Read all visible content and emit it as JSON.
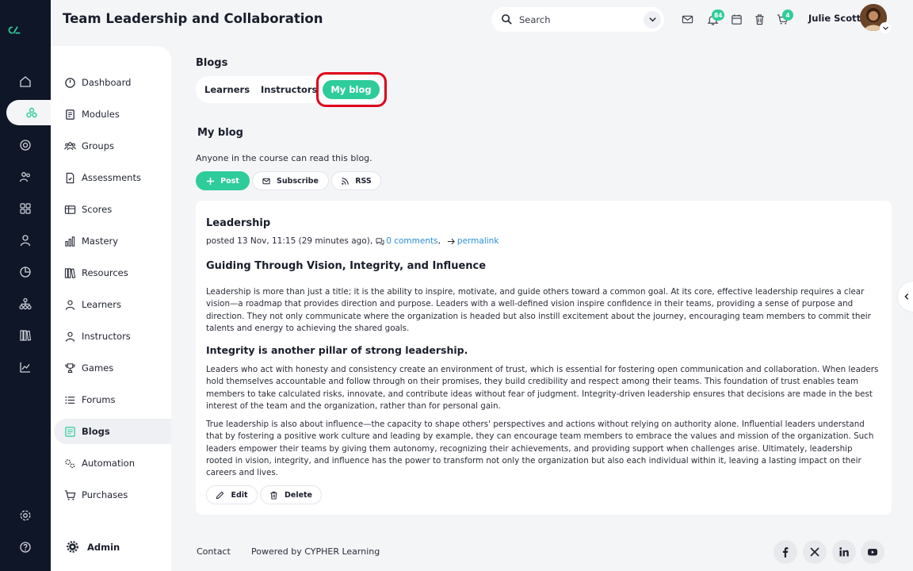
{
  "header": {
    "title": "Team Leadership and Collaboration",
    "search_placeholder": "Search",
    "notifications_count": "84",
    "cart_count": "4",
    "user_name": "Julie Scott"
  },
  "sidebar": {
    "items": [
      {
        "label": "Dashboard",
        "icon": "dashboard-icon"
      },
      {
        "label": "Modules",
        "icon": "modules-icon"
      },
      {
        "label": "Groups",
        "icon": "groups-icon"
      },
      {
        "label": "Assessments",
        "icon": "assessments-icon"
      },
      {
        "label": "Scores",
        "icon": "scores-icon"
      },
      {
        "label": "Mastery",
        "icon": "mastery-icon"
      },
      {
        "label": "Resources",
        "icon": "resources-icon"
      },
      {
        "label": "Learners",
        "icon": "learners-icon"
      },
      {
        "label": "Instructors",
        "icon": "instructors-icon"
      },
      {
        "label": "Games",
        "icon": "games-icon"
      },
      {
        "label": "Forums",
        "icon": "forums-icon"
      },
      {
        "label": "Blogs",
        "icon": "blogs-icon",
        "active": true
      },
      {
        "label": "Automation",
        "icon": "automation-icon"
      },
      {
        "label": "Purchases",
        "icon": "purchases-icon"
      }
    ],
    "admin_label": "Admin"
  },
  "main": {
    "section_title": "Blogs",
    "tabs": [
      {
        "label": "Learners"
      },
      {
        "label": "Instructors"
      },
      {
        "label": "My blog",
        "active": true
      }
    ],
    "blog_title": "My blog",
    "blog_description": "Anyone in the course can read this blog.",
    "actions": {
      "post": "Post",
      "subscribe": "Subscribe",
      "rss": "RSS"
    },
    "post": {
      "title": "Leadership",
      "posted": "posted 13 Nov, 11:15 (29 minutes ago),",
      "comments": "0 comments",
      "comma": ",",
      "permalink": "permalink",
      "heading": "Guiding Through Vision, Integrity, and Influence",
      "paragraph1": "Leadership is more than just a title; it is the ability to inspire, motivate, and guide others toward a common goal. At its core, effective leadership requires a clear vision—a roadmap that provides direction and purpose. Leaders with a well-defined vision inspire confidence in their teams, providing a sense of purpose and direction. They not only communicate where the organization is headed but also instill excitement about the journey, encouraging team members to commit their talents and energy to achieving the shared goals.",
      "subheading": "Integrity is another pillar of strong leadership.",
      "paragraph2": "Leaders who act with honesty and consistency create an environment of trust, which is essential for fostering open communication and collaboration. When leaders hold themselves accountable and follow through on their promises, they build credibility and respect among their teams. This foundation of trust enables team members to take calculated risks, innovate, and contribute ideas without fear of judgment. Integrity-driven leadership ensures that decisions are made in the best interest of the team and the organization, rather than for personal gain.",
      "paragraph3": "True leadership is also about influence—the capacity to shape others' perspectives and actions without relying on authority alone. Influential leaders understand that by fostering a positive work culture and leading by example, they can encourage team members to embrace the values and mission of the organization. Such leaders empower their teams by giving them autonomy, recognizing their achievements, and providing support when challenges arise. Ultimately, leadership rooted in vision, integrity, and influence has the power to transform not only the organization but also each individual within it, leaving a lasting impact on their careers and lives.",
      "edit": "Edit",
      "delete": "Delete"
    }
  },
  "footer": {
    "contact": "Contact",
    "powered_by": "Powered by CYPHER Learning",
    "social": [
      "facebook-icon",
      "x-icon",
      "linkedin-icon",
      "youtube-icon"
    ]
  },
  "colors": {
    "accent": "#2ecc9a",
    "rail": "#0f1627",
    "link": "#2a8fd6",
    "highlight": "#e0001b"
  }
}
